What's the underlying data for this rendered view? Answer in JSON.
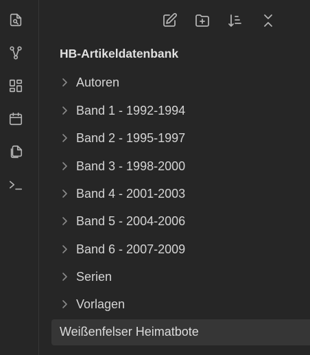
{
  "ribbon": {
    "items": [
      {
        "icon": "search-file-icon"
      },
      {
        "icon": "graph-icon"
      },
      {
        "icon": "dashboard-icon"
      },
      {
        "icon": "calendar-icon"
      },
      {
        "icon": "copy-pages-icon"
      },
      {
        "icon": "terminal-icon"
      }
    ]
  },
  "toolbar": {
    "icons": [
      "new-note-icon",
      "new-folder-icon",
      "sort-icon",
      "collapse-all-icon"
    ]
  },
  "explorer": {
    "vault_title": "HB-Artikeldatenbank",
    "folders": [
      {
        "label": "Autoren"
      },
      {
        "label": "Band 1 - 1992-1994"
      },
      {
        "label": "Band 2 - 1995-1997"
      },
      {
        "label": "Band 3 - 1998-2000"
      },
      {
        "label": "Band 4 - 2001-2003"
      },
      {
        "label": "Band 5 - 2004-2006"
      },
      {
        "label": "Band 6 - 2007-2009"
      },
      {
        "label": "Serien"
      },
      {
        "label": "Vorlagen"
      }
    ],
    "active_file": "Weißenfelser Heimatbote"
  }
}
